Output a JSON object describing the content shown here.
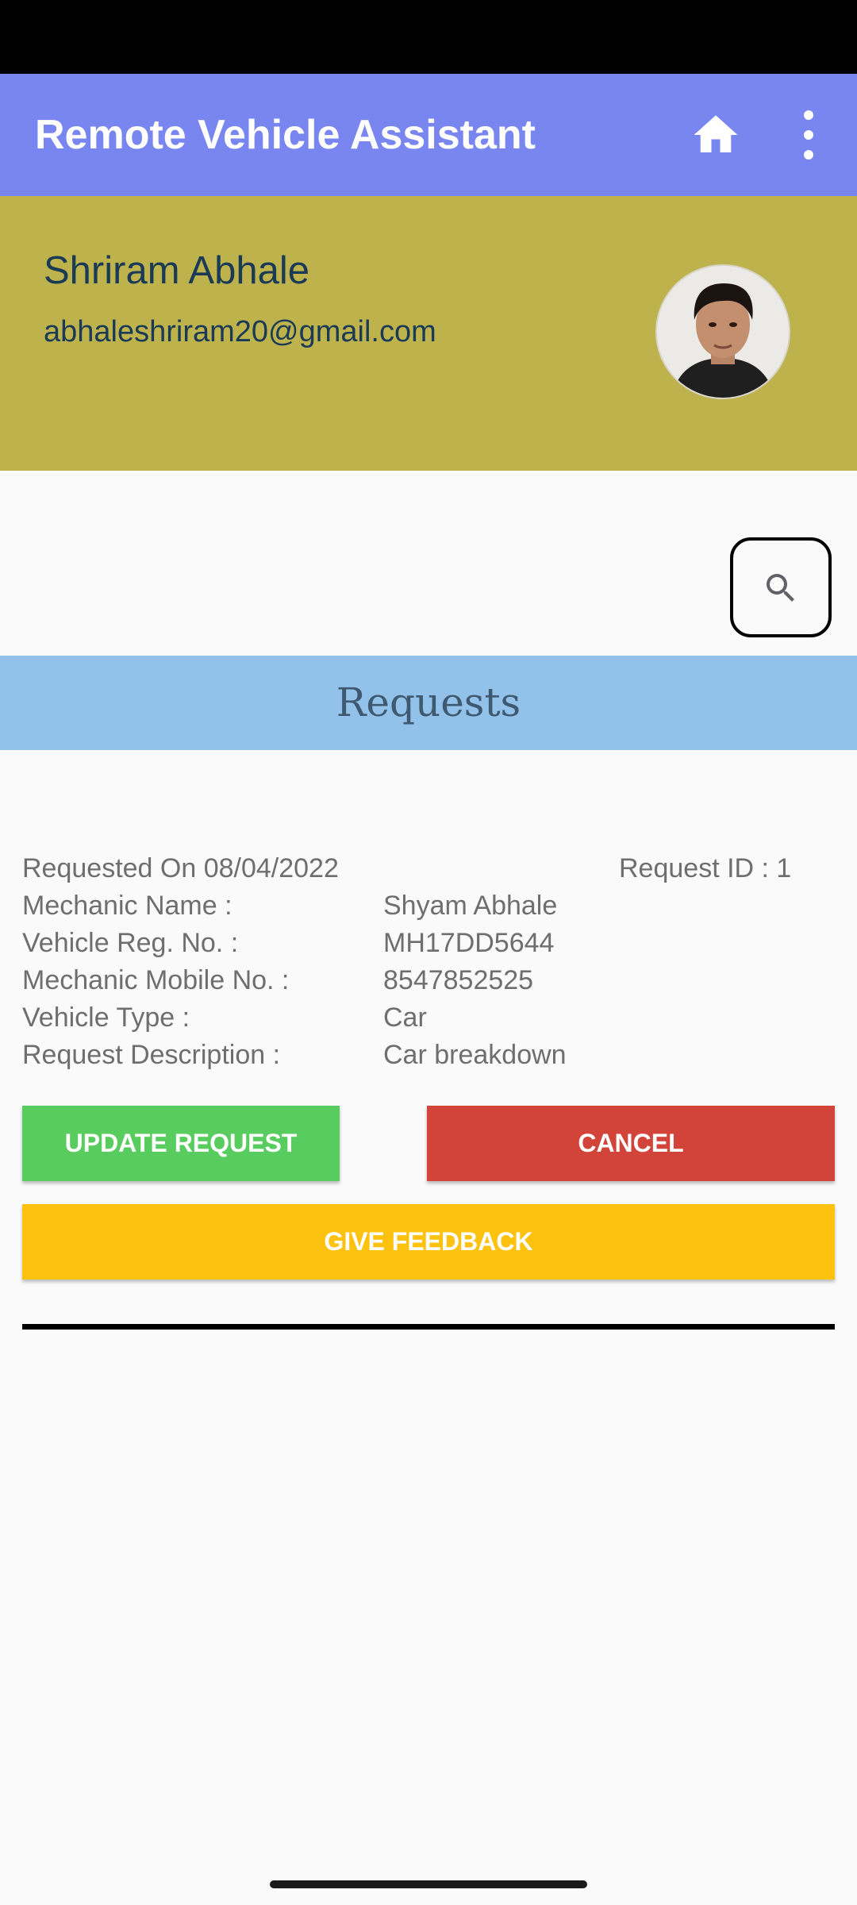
{
  "app_bar": {
    "title": "Remote Vehicle Assistant",
    "home_icon": "home-icon",
    "more_icon": "more-vert-icon",
    "color": "#7986f0"
  },
  "profile": {
    "name": "Shriram Abhale",
    "email": "abhaleshriram20@gmail.com",
    "background": "#bdb24c"
  },
  "search": {
    "icon": "search-icon"
  },
  "section": {
    "title": "Requests",
    "background": "#92c1e9"
  },
  "request": {
    "requested_on": "Requested On 08/04/2022",
    "request_id": "Request ID : 1",
    "fields": [
      {
        "label": "Mechanic Name :",
        "value": "Shyam Abhale"
      },
      {
        "label": "Vehicle Reg. No. :",
        "value": "MH17DD5644"
      },
      {
        "label": "Mechanic Mobile No. :",
        "value": "8547852525"
      },
      {
        "label": "Vehicle Type :",
        "value": "Car"
      },
      {
        "label": "Request Description :",
        "value": "Car breakdown"
      }
    ]
  },
  "actions": {
    "update_label": "UPDATE REQUEST",
    "cancel_label": "CANCEL",
    "feedback_label": "GIVE FEEDBACK",
    "update_color": "#58cc5e",
    "cancel_color": "#d2433a",
    "feedback_color": "#fdc10f"
  }
}
